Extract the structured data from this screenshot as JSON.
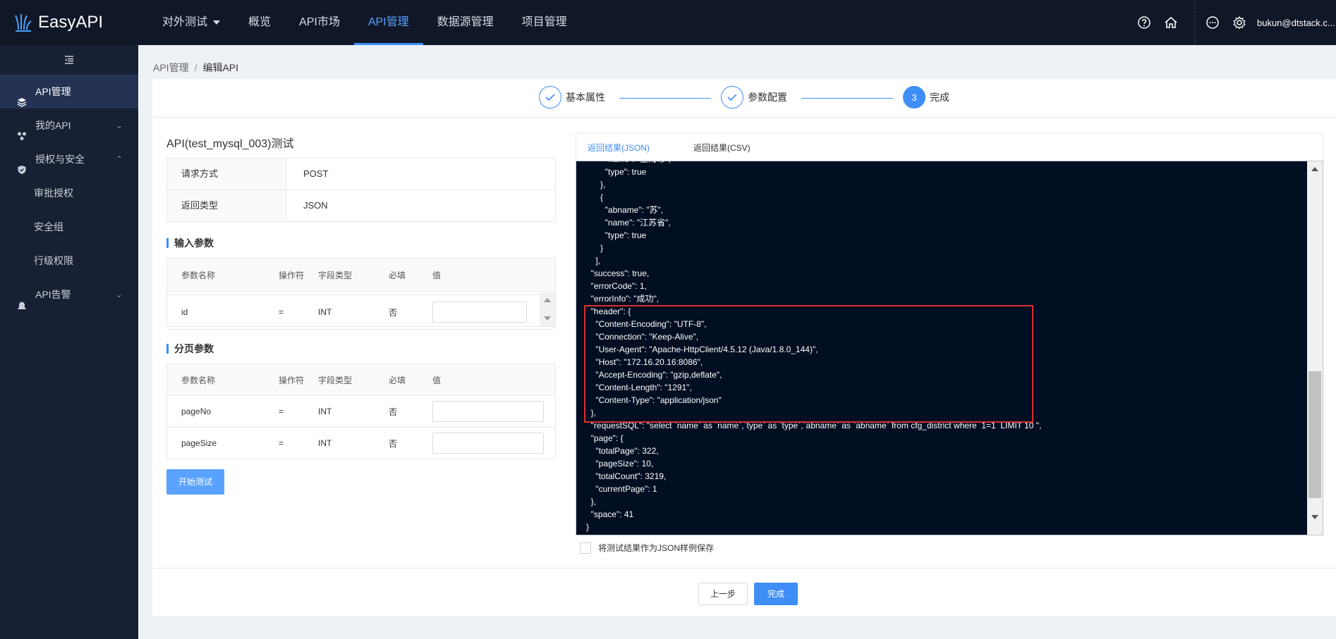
{
  "app": {
    "name": "EasyAPI"
  },
  "nav": {
    "items": [
      {
        "label": "对外测试",
        "dropdown": true
      },
      {
        "label": "概览"
      },
      {
        "label": "API市场"
      },
      {
        "label": "API管理",
        "active": true
      },
      {
        "label": "数据源管理"
      },
      {
        "label": "项目管理"
      }
    ],
    "user": "bukun@dtstack.c..."
  },
  "sidebar": {
    "items": [
      {
        "label": "API管理",
        "icon": "layers-icon",
        "active": true
      },
      {
        "label": "我的API",
        "icon": "api-icon",
        "chevron": "down"
      },
      {
        "label": "授权与安全",
        "icon": "shield-icon",
        "chevron": "up"
      },
      {
        "label": "审批授权",
        "sub": true
      },
      {
        "label": "安全组",
        "sub": true
      },
      {
        "label": "行级权限",
        "sub": true
      },
      {
        "label": "API告警",
        "icon": "alarm-icon",
        "chevron": "down"
      }
    ]
  },
  "breadcrumb": {
    "parent": "API管理",
    "current": "编辑API",
    "separator": "/"
  },
  "steps": [
    {
      "label": "基本属性",
      "state": "done"
    },
    {
      "label": "参数配置",
      "state": "done"
    },
    {
      "label": "完成",
      "number": "3",
      "state": "current"
    }
  ],
  "api_test": {
    "title": "API(test_mysql_003)测试",
    "request_method_label": "请求方式",
    "request_method_value": "POST",
    "return_type_label": "返回类型",
    "return_type_value": "JSON"
  },
  "input_params": {
    "title": "输入参数",
    "headers": [
      "参数名称",
      "操作符",
      "字段类型",
      "必填",
      "值"
    ],
    "rows": [
      {
        "name": "id",
        "op": "=",
        "type": "INT",
        "required": "否",
        "value": ""
      }
    ]
  },
  "page_params": {
    "title": "分页参数",
    "headers": [
      "参数名称",
      "操作符",
      "字段类型",
      "必填",
      "值"
    ],
    "rows": [
      {
        "name": "pageNo",
        "op": "=",
        "type": "INT",
        "required": "否",
        "value": ""
      },
      {
        "name": "pageSize",
        "op": "=",
        "type": "INT",
        "required": "否",
        "value": ""
      }
    ]
  },
  "start_test_button": "开始测试",
  "result_tabs": [
    {
      "label": "返回结果(JSON)",
      "active": true
    },
    {
      "label": "返回结果(CSV)"
    }
  ],
  "result_json": "        \"name\": \"上海市\",\n        \"type\": true\n      },\n      {\n        \"abname\": \"苏\",\n        \"name\": \"江苏省\",\n        \"type\": true\n      }\n    ],\n  \"success\": true,\n  \"errorCode\": 1,\n  \"errorInfo\": \"成功\",\n  \"header\": {\n    \"Content-Encoding\": \"UTF-8\",\n    \"Connection\": \"Keep-Alive\",\n    \"User-Agent\": \"Apache-HttpClient/4.5.12 (Java/1.8.0_144)\",\n    \"Host\": \"172.16.20.16:8086\",\n    \"Accept-Encoding\": \"gzip,deflate\",\n    \"Content-Length\": \"1291\",\n    \"Content-Type\": \"application/json\"\n  },\n  \"requestSQL\": \"select `name` as `name`,`type` as `type`,`abname` as `abname` from cfg_district where  1=1  LIMIT 10 \",\n  \"page\": {\n    \"totalPage\": 322,\n    \"pageSize\": 10,\n    \"totalCount\": 3219,\n    \"currentPage\": 1\n  },\n  \"space\": 41\n}",
  "save_sample_checkbox": {
    "label": "将测试结果作为JSON样例保存",
    "checked": false
  },
  "footer": {
    "prev_button": "上一步",
    "finish_button": "完成"
  },
  "colors": {
    "topbar": "#101827",
    "sidebar": "#182033",
    "accent": "#3f8ef7",
    "code_bg": "#020e22",
    "highlight": "#d9312d"
  }
}
